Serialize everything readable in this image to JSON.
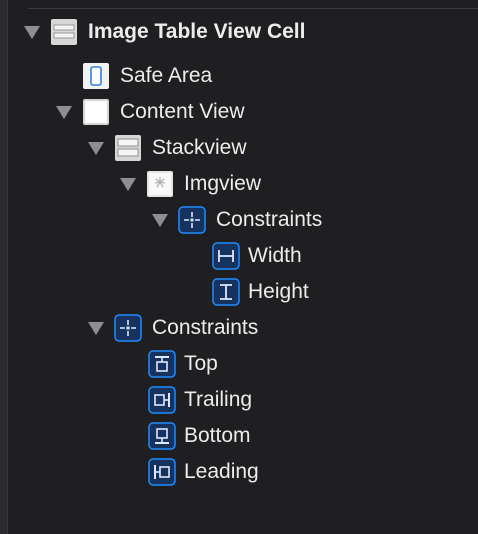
{
  "tree": {
    "root": {
      "label": "Image Table View Cell",
      "icon": "table-cell-icon"
    },
    "safe_area": {
      "label": "Safe Area",
      "icon": "safe-area-icon"
    },
    "content_view": {
      "label": "Content View",
      "icon": "view-icon"
    },
    "stackview": {
      "label": "Stackview",
      "icon": "stack-view-icon"
    },
    "imgview": {
      "label": "Imgview",
      "icon": "image-view-icon"
    },
    "img_constraints": {
      "label": "Constraints",
      "icon": "constraints-icon"
    },
    "width": {
      "label": "Width",
      "icon": "width-constraint-icon"
    },
    "height": {
      "label": "Height",
      "icon": "height-constraint-icon"
    },
    "cv_constraints": {
      "label": "Constraints",
      "icon": "constraints-icon"
    },
    "top": {
      "label": "Top",
      "icon": "top-constraint-icon"
    },
    "trailing": {
      "label": "Trailing",
      "icon": "trailing-constraint-icon"
    },
    "bottom": {
      "label": "Bottom",
      "icon": "bottom-constraint-icon"
    },
    "leading": {
      "label": "Leading",
      "icon": "leading-constraint-icon"
    }
  },
  "colors": {
    "background": "#1f1f21",
    "accent": "#1e8bff",
    "text": "#ececec"
  }
}
